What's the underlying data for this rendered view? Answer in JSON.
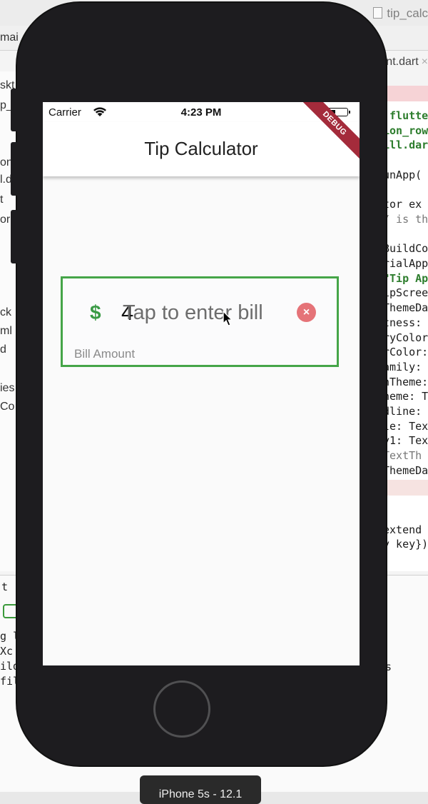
{
  "ide": {
    "file_title": "tip_calc",
    "branch": "mai",
    "open_tab": "nt.dart",
    "left_fragments": [
      "skt",
      "p_c",
      "on",
      "l.d",
      "t",
      "or",
      "ck",
      "ml",
      "d",
      "ies",
      "Co"
    ],
    "right_code": [
      ":flutte",
      "ion_row",
      "ill.dar",
      "",
      "unApp(",
      "",
      "tor ex",
      "/ is th",
      "",
      "BuildCo",
      "rialApp",
      "\"Tip Ap",
      "ipScree",
      "ThemeDa",
      "tness:",
      "ryColor",
      "rColor:",
      "amily:",
      "nTheme:",
      "heme: T",
      "dline:",
      "le: Tex",
      "y1: Tex",
      " TextTh",
      "ThemeDa",
      "",
      "",
      "",
      " extend",
      "y key})"
    ],
    "console_lines": [
      "g l",
      " Xc",
      "ild",
      "fil"
    ],
    "console_right": "s",
    "console_tab": "t",
    "device_label": "iPhone 5s - 12.1"
  },
  "status_bar": {
    "carrier": "Carrier",
    "time": "4:23 PM"
  },
  "app": {
    "title": "Tip Calculator",
    "debug_banner": "DEBUG",
    "bill": {
      "currency_symbol": "$",
      "value": "4",
      "placeholder": "Tap to enter bill",
      "clear_symbol": "×",
      "label": "Bill Amount"
    }
  },
  "colors": {
    "accent_green": "#45a548",
    "clear_red": "#e57378",
    "debug_red": "#a42b3b",
    "phone_body": "#1d1c1f"
  },
  "icons": [
    "wifi-icon",
    "battery-icon",
    "dollar-icon",
    "clear-icon",
    "mouse-cursor-icon",
    "home-button"
  ]
}
